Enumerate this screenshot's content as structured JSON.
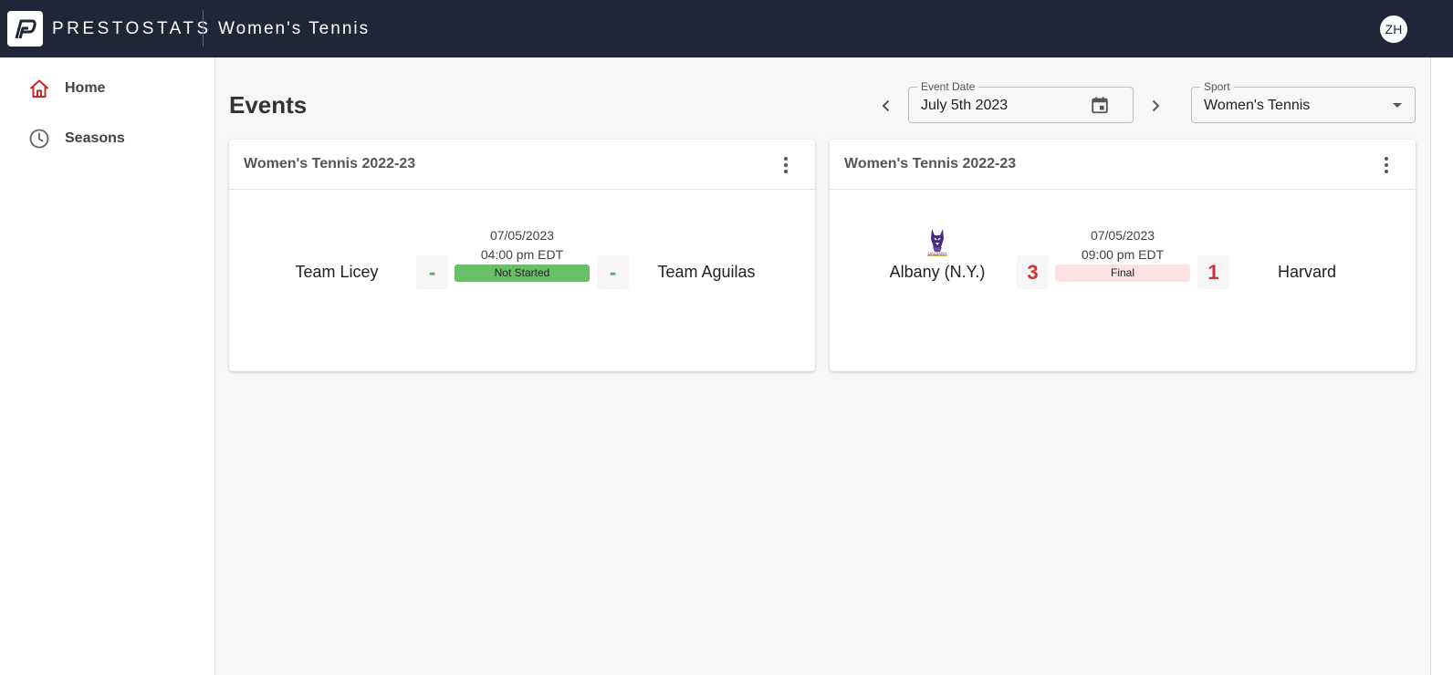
{
  "header": {
    "brand": "PRESTOSTATS",
    "app_title": "Women's Tennis",
    "user_initials": "ZH"
  },
  "sidebar": {
    "items": [
      {
        "label": "Home",
        "icon": "home-icon",
        "active": true
      },
      {
        "label": "Seasons",
        "icon": "clock-icon",
        "active": false
      }
    ]
  },
  "main": {
    "title": "Events",
    "event_date": {
      "label": "Event Date",
      "value": "July 5th 2023"
    },
    "sport": {
      "label": "Sport",
      "value": "Women's Tennis"
    }
  },
  "events": [
    {
      "season": "Women's Tennis 2022-23",
      "home_team": "Team Licey",
      "away_team": "Team Aguilas",
      "home_score": "-",
      "away_score": "-",
      "date": "07/05/2023",
      "time": "04:00 pm EDT",
      "status": "Not Started"
    },
    {
      "season": "Women's Tennis 2022-23",
      "home_team": "Albany (N.Y.)",
      "home_logo_text": "UALBANY",
      "away_team": "Harvard",
      "home_score": "3",
      "away_score": "1",
      "date": "07/05/2023",
      "time": "09:00 pm EDT",
      "status": "Final"
    }
  ],
  "colors": {
    "topbar": "#1f2638",
    "accent_red": "#c62828",
    "not_started": "#6abf69",
    "final_bg": "#fde2e4",
    "score_red": "#d32f2f",
    "score_dash": "#4caf50"
  }
}
